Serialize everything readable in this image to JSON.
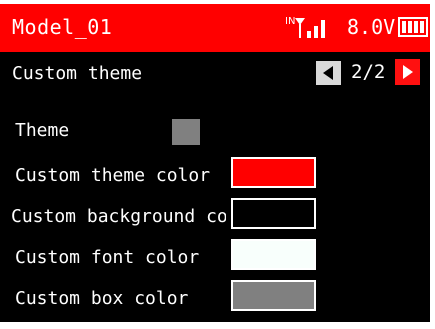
{
  "header": {
    "model_name": "Model_01",
    "signal_label": "IN",
    "signal_icon": "signal-bars-icon",
    "voltage": "8.0V",
    "battery_icon": "battery-icon",
    "accent_color": "#ff0000"
  },
  "page": {
    "title": "Custom theme",
    "indicator": "2/2",
    "prev_icon": "triangle-left-icon",
    "next_icon": "triangle-right-icon"
  },
  "settings": [
    {
      "label": "Theme",
      "color": "#808080"
    },
    {
      "label": "Custom theme color",
      "color": "#ff0000"
    },
    {
      "label": "Custom background co",
      "color": "#000000"
    },
    {
      "label": "Custom font color",
      "color": "#f8fffc"
    },
    {
      "label": "Custom box color",
      "color": "#808080"
    }
  ]
}
